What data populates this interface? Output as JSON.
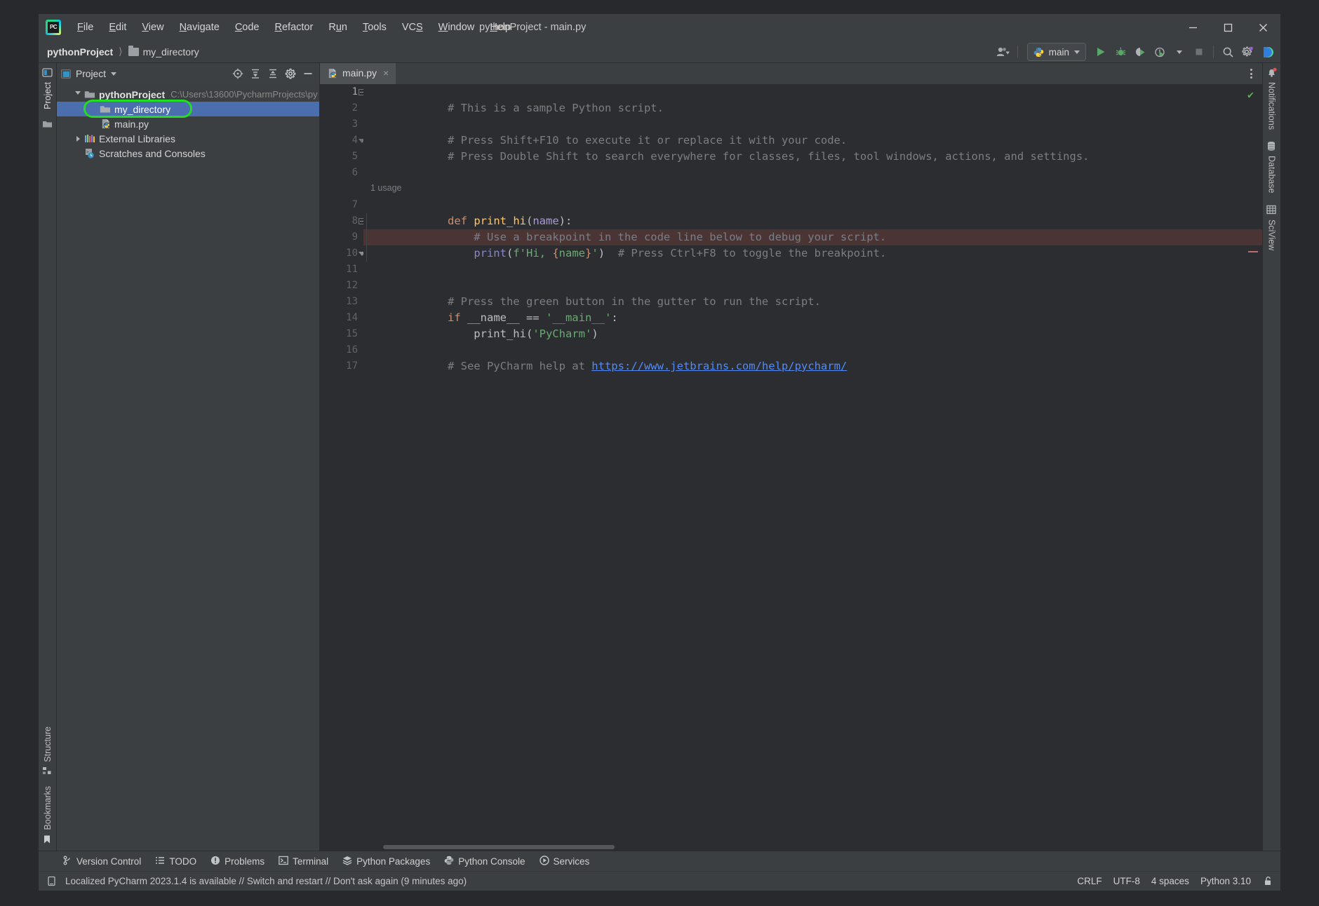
{
  "window": {
    "title": "pythonProject - main.py",
    "logo": "pycharm-logo",
    "minimize": "minimize-icon",
    "maximize": "maximize-icon",
    "close": "close-icon"
  },
  "menu": {
    "items": [
      {
        "label": "File",
        "mnemonic": "F"
      },
      {
        "label": "Edit",
        "mnemonic": "E"
      },
      {
        "label": "View",
        "mnemonic": "V"
      },
      {
        "label": "Navigate",
        "mnemonic": "N"
      },
      {
        "label": "Code",
        "mnemonic": "C"
      },
      {
        "label": "Refactor",
        "mnemonic": "R"
      },
      {
        "label": "Run",
        "mnemonic": "u"
      },
      {
        "label": "Tools",
        "mnemonic": "T"
      },
      {
        "label": "VCS",
        "mnemonic": "S"
      },
      {
        "label": "Window",
        "mnemonic": "W"
      },
      {
        "label": "Help",
        "mnemonic": "H"
      }
    ]
  },
  "navbar": {
    "breadcrumbs": [
      {
        "label": "pythonProject",
        "icon": "none"
      },
      {
        "label": "my_directory",
        "icon": "folder-icon"
      }
    ],
    "run_config": {
      "label": "main",
      "icon": "python-icon"
    },
    "actions": [
      {
        "name": "account-icon",
        "label": ""
      },
      {
        "name": "run-icon",
        "label": ""
      },
      {
        "name": "debug-icon",
        "label": ""
      },
      {
        "name": "run-coverage-icon",
        "label": ""
      },
      {
        "name": "profiler-icon",
        "label": ""
      },
      {
        "name": "stop-icon",
        "label": ""
      },
      {
        "name": "search-icon",
        "label": ""
      },
      {
        "name": "settings-icon",
        "label": ""
      },
      {
        "name": "ai-assistant-icon",
        "label": ""
      }
    ]
  },
  "left_stripe": {
    "top": [
      {
        "label": "Project",
        "icon": "project-icon",
        "active": true
      },
      {
        "label": "",
        "icon": "folder-icon"
      }
    ],
    "bottom": [
      {
        "label": "Structure",
        "icon": "structure-icon"
      },
      {
        "label": "Bookmarks",
        "icon": "bookmark-icon"
      }
    ]
  },
  "right_stripe": {
    "items": [
      {
        "label": "Notifications",
        "icon": "bell-icon",
        "badge": true
      },
      {
        "label": "Database",
        "icon": "database-icon"
      },
      {
        "label": "SciView",
        "icon": "sciview-icon"
      }
    ]
  },
  "project_panel": {
    "title": "Project",
    "actions": [
      "select-opened-file-icon",
      "expand-all-icon",
      "collapse-all-icon",
      "settings-icon",
      "hide-icon"
    ],
    "tree": [
      {
        "label": "pythonProject",
        "path": "C:\\Users\\13600\\PycharmProjects\\py",
        "icon": "folder-icon",
        "indent": 0,
        "arrow": "open",
        "bold": true,
        "selected": false
      },
      {
        "label": "my_directory",
        "path": "",
        "icon": "folder-icon",
        "indent": 1,
        "arrow": "none",
        "bold": false,
        "selected": true,
        "highlighted": true
      },
      {
        "label": "main.py",
        "path": "",
        "icon": "python-file-icon",
        "indent": 1,
        "arrow": "none",
        "bold": false,
        "selected": false
      },
      {
        "label": "External Libraries",
        "path": "",
        "icon": "libraries-icon",
        "indent": 0,
        "arrow": "closed",
        "bold": false,
        "selected": false
      },
      {
        "label": "Scratches and Consoles",
        "path": "",
        "icon": "scratches-icon",
        "indent": 0,
        "arrow": "none",
        "bold": false,
        "selected": false
      }
    ]
  },
  "editor": {
    "tab": {
      "label": "main.py",
      "icon": "python-file-icon",
      "close": "×"
    },
    "inspection_status": "✔",
    "usage_hint": "1 usage",
    "line_numbers": [
      "1",
      "2",
      "3",
      "4",
      "5",
      "6",
      "7",
      "8",
      "9",
      "10",
      "11",
      "12",
      "13",
      "14",
      "15",
      "16",
      "17"
    ],
    "code": [
      {
        "n": 1,
        "text": "# This is a sample Python script."
      },
      {
        "n": 2,
        "text": ""
      },
      {
        "n": 3,
        "text": "# Press Shift+F10 to execute it or replace it with your code."
      },
      {
        "n": 4,
        "text": "# Press Double Shift to search everywhere for classes, files, tool windows, actions, and settings."
      },
      {
        "n": 5,
        "text": ""
      },
      {
        "n": 6,
        "text": ""
      },
      {
        "n": 7,
        "text": "def print_hi(name):"
      },
      {
        "n": 8,
        "text": "    # Use a breakpoint in the code line below to debug your script."
      },
      {
        "n": 9,
        "text": "    print(f'Hi, {name}')  # Press Ctrl+F8 to toggle the breakpoint."
      },
      {
        "n": 10,
        "text": ""
      },
      {
        "n": 11,
        "text": ""
      },
      {
        "n": 12,
        "text": "# Press the green button in the gutter to run the script."
      },
      {
        "n": 13,
        "text": "if __name__ == '__main__':"
      },
      {
        "n": 14,
        "text": "    print_hi('PyCharm')"
      },
      {
        "n": 15,
        "text": ""
      },
      {
        "n": 16,
        "text": "# See PyCharm help at https://www.jetbrains.com/help/pycharm/"
      },
      {
        "n": 17,
        "text": ""
      }
    ],
    "breakpoint_line": 9,
    "run_marker_line": 13,
    "link": "https://www.jetbrains.com/help/pycharm/"
  },
  "bottom_tools": [
    {
      "label": "Version Control",
      "icon": "branch-icon"
    },
    {
      "label": "TODO",
      "icon": "todo-icon"
    },
    {
      "label": "Problems",
      "icon": "problems-icon"
    },
    {
      "label": "Terminal",
      "icon": "terminal-icon"
    },
    {
      "label": "Python Packages",
      "icon": "packages-icon"
    },
    {
      "label": "Python Console",
      "icon": "python-console-icon"
    },
    {
      "label": "Services",
      "icon": "services-icon"
    }
  ],
  "statusbar": {
    "icon": "memory-icon",
    "message": "Localized PyCharm 2023.1.4 is available // Switch and restart // Don't ask again (9 minutes ago)",
    "right": [
      {
        "label": "CRLF"
      },
      {
        "label": "UTF-8"
      },
      {
        "label": "4 spaces"
      },
      {
        "label": "Python 3.10"
      }
    ],
    "lock_icon": "unlocked-icon"
  },
  "colors": {
    "accent_blue": "#4b6eaf",
    "highlight_green": "#22dd22",
    "breakpoint_red": "#db5c5c",
    "run_green": "#5ca85c",
    "editor_bg": "#2b2d30",
    "panel_bg": "#3c3f41"
  }
}
